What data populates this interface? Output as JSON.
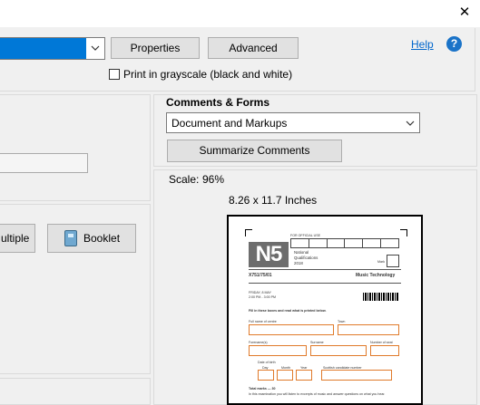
{
  "window": {
    "close_glyph": "✕"
  },
  "printer": {
    "properties_button": "Properties",
    "advanced_button": "Advanced",
    "help_link": "Help",
    "grayscale_label": "Print in grayscale (black and white)"
  },
  "comments_forms": {
    "heading": "Comments & Forms",
    "selected_option": "Document and Markups",
    "summarize_button": "Summarize Comments"
  },
  "page_sizing": {
    "multiple_button": "ultiple",
    "booklet_button": "Booklet"
  },
  "preview": {
    "scale_label": "Scale:",
    "scale_value": "96%",
    "page_size": "8.26 x 11.7 Inches",
    "doc": {
      "for_official_use": "FOR OFFICIAL USE",
      "logo": "N5",
      "qual_1": "National",
      "qual_2": "Qualifications",
      "qual_3": "2018",
      "mark_label": "Mark",
      "code": "X751/75/01",
      "subject": "Music Technology",
      "date_1": "FRIDAY, 8 MAY",
      "date_2": "2:00 PM - 3:00 PM",
      "instruction": "Fill in these boxes and read what is printed below.",
      "full_name": "Full name of centre",
      "town": "Town",
      "forenames": "Forename(s)",
      "surname": "Surname",
      "seat": "Number of seat",
      "dob": "Date of birth",
      "day": "Day",
      "month": "Month",
      "year": "Year",
      "scn": "Scottish candidate number",
      "total_marks": "Total marks — 30",
      "footer": "In this examination you will listen to excerpts of music and answer questions on what you hear."
    }
  },
  "colors": {
    "accent_blue": "#0078d7",
    "form_orange": "#e07a2a",
    "help_icon": "#1a73c8"
  }
}
